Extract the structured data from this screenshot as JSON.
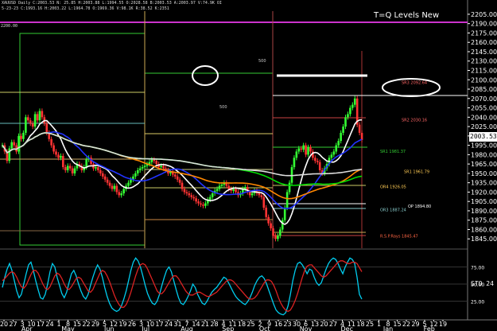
{
  "header": {
    "line1": "XAUUSD  Daily  C:2003.53  N: 25.85  H:2003.88  L:1994.55  O:2028.58  B:2003.53  A:2003.97  V:74.9K  OI",
    "line2": "5-23-23  C:1993.16  H:2003.22  L:1964.78  O:1969.36  V:98.1K  R:38.52  K:2351",
    "line3": "2200.00"
  },
  "levels_title": "T=Q Levels New",
  "price_badge": "2003.53",
  "sto_label": "STO 24",
  "chart_data": [
    {
      "type": "candlestick",
      "title": "XAUUSD Daily",
      "xlabel": "",
      "ylabel": "",
      "ylim": [
        1830,
        2210
      ],
      "y_ticks": [
        2205,
        2190,
        2175,
        2160,
        2145,
        2130,
        2115,
        2100,
        2085,
        2070,
        2055,
        2040,
        2025,
        2010,
        1995,
        1980,
        1965,
        1950,
        1935,
        1920,
        1905,
        1890,
        1875,
        1860,
        1845
      ],
      "y_tick_labels": [
        "2205.00",
        "2190.00",
        "2175.00",
        "2160.00",
        "2145.00",
        "2130.00",
        "2115.00",
        "2100.00",
        "2085.00",
        "2070.00",
        "2055.00",
        "2040.00",
        "2025.00",
        "2010.00",
        "1995.00",
        "1980.00",
        "1965.00",
        "1950.00",
        "1935.00",
        "1920.00",
        "1905.00",
        "1890.00",
        "1875.00",
        "1860.00",
        "1845.00"
      ],
      "x_day_labels": [
        "20",
        "27",
        "3",
        "10",
        "17",
        "24",
        "1",
        "8",
        "15",
        "22",
        "29",
        "5",
        "12",
        "19",
        "26",
        "3",
        "10",
        "17",
        "24",
        "31",
        "7",
        "14",
        "21",
        "28",
        "4",
        "11",
        "18",
        "25",
        "2",
        "9",
        "16",
        "23",
        "30",
        "6",
        "13",
        "20",
        "27",
        "4",
        "11",
        "18",
        "25",
        "1",
        "8",
        "15",
        "22",
        "29",
        "5",
        "12",
        "19"
      ],
      "x_month_labels": [
        "Apr",
        "May",
        "Jun",
        "Jul",
        "Aug",
        "Sep",
        "Oct",
        "Nov",
        "Dec",
        "Jan",
        "Feb"
      ],
      "last_price": 2003.53,
      "close": [
        1995,
        1985,
        1970,
        1990,
        2000,
        1995,
        1985,
        2010,
        2005,
        2015,
        2040,
        2035,
        2030,
        2025,
        2045,
        2035,
        2050,
        2040,
        2030,
        2015,
        2005,
        1995,
        1985,
        1980,
        1975,
        1978,
        1960,
        1955,
        1962,
        1958,
        1950,
        1958,
        1965,
        1962,
        1955,
        1960,
        1972,
        1975,
        1965,
        1958,
        1960,
        1955,
        1950,
        1945,
        1940,
        1935,
        1930,
        1925,
        1930,
        1920,
        1915,
        1918,
        1925,
        1930,
        1935,
        1940,
        1945,
        1950,
        1955,
        1958,
        1960,
        1962,
        1965,
        1968,
        1972,
        1970,
        1965,
        1960,
        1962,
        1958,
        1955,
        1950,
        1952,
        1948,
        1945,
        1940,
        1935,
        1925,
        1920,
        1918,
        1915,
        1912,
        1910,
        1905,
        1902,
        1900,
        1898,
        1902,
        1908,
        1912,
        1918,
        1922,
        1925,
        1930,
        1932,
        1935,
        1930,
        1925,
        1922,
        1925,
        1920,
        1915,
        1918,
        1925,
        1928,
        1920,
        1915,
        1918,
        1922,
        1918,
        1915,
        1912,
        1895,
        1880,
        1870,
        1862,
        1850,
        1845,
        1850,
        1860,
        1875,
        1895,
        1920,
        1935,
        1960,
        1975,
        1985,
        1990,
        1988,
        1995,
        1980,
        1992,
        1985,
        1975,
        1970,
        1968,
        1955,
        1950,
        1958,
        1965,
        1975,
        1980,
        1985,
        1995,
        2002,
        2015,
        2025,
        2040,
        2045,
        2055,
        2060,
        2070,
        2028,
        2015,
        2003.53
      ],
      "moving_averages": [
        {
          "color": "#ffffff",
          "period": 10
        },
        {
          "color": "#2233ff",
          "period": 20
        },
        {
          "color": "#ff8800",
          "period": 50
        },
        {
          "color": "#00dd00",
          "period": 100
        },
        {
          "color": "#dddddd",
          "period": 200
        }
      ],
      "level_labels": [
        {
          "text": "500",
          "price": 2127
        },
        {
          "text": "500",
          "price": 2053
        },
        {
          "text": "SR3 2092.64",
          "price": 2092
        },
        {
          "text": "SR2 2030.16",
          "price": 2032
        },
        {
          "text": "SR1 1981.37",
          "price": 1982
        },
        {
          "text": "SR1 1961.79",
          "price": 1949
        },
        {
          "text": "OR4 1926.05",
          "price": 1925
        },
        {
          "text": "OP 1894.80",
          "price": 1894
        },
        {
          "text": "OR3 1887.24",
          "price": 1888
        },
        {
          "text": "R.S.P.Rays 1845.47",
          "price": 1846
        }
      ]
    },
    {
      "type": "line",
      "title": "STO 24",
      "ylim": [
        0,
        100
      ],
      "y_ticks": [
        75,
        50,
        25
      ],
      "y_tick_labels": [
        "75.00",
        "50.00",
        "25.00"
      ],
      "series": [
        {
          "name": "",
          "color": "#00ccee",
          "values": [
            45,
            60,
            72,
            80,
            70,
            55,
            40,
            30,
            35,
            50,
            65,
            78,
            82,
            70,
            55,
            42,
            30,
            28,
            35,
            50,
            68,
            80,
            75,
            60,
            48,
            36,
            30,
            38,
            52,
            65,
            70,
            62,
            50,
            40,
            32,
            28,
            35,
            48,
            60,
            70,
            78,
            72,
            60,
            45,
            32,
            22,
            15,
            12,
            10,
            12,
            18,
            28,
            40,
            55,
            70,
            82,
            88,
            84,
            75,
            62,
            48,
            36,
            28,
            22,
            20,
            25,
            35,
            48,
            60,
            70,
            75,
            68,
            55,
            42,
            30,
            22,
            20,
            25,
            32,
            40,
            50,
            45,
            35,
            28,
            22,
            20,
            25,
            32,
            38,
            42,
            45,
            50,
            55,
            60,
            58,
            52,
            45,
            38,
            32,
            28,
            25,
            22,
            20,
            24,
            30,
            38,
            48,
            55,
            60,
            62,
            58,
            50,
            40,
            30,
            20,
            12,
            8,
            6,
            5,
            8,
            18,
            35,
            55,
            70,
            80,
            82,
            78,
            72,
            65,
            72,
            70,
            60,
            52,
            48,
            52,
            62,
            72,
            80,
            85,
            88,
            86,
            80,
            72,
            65,
            75,
            82,
            88,
            86,
            80,
            60,
            35,
            28
          ]
        },
        {
          "name": "",
          "color": "#dd2222",
          "values": [
            55,
            58,
            62,
            66,
            68,
            66,
            60,
            52,
            46,
            44,
            48,
            56,
            64,
            70,
            70,
            66,
            58,
            50,
            44,
            42,
            46,
            54,
            62,
            66,
            64,
            58,
            50,
            44,
            42,
            46,
            52,
            58,
            60,
            58,
            52,
            46,
            40,
            38,
            42,
            50,
            58,
            66,
            70,
            68,
            62,
            54,
            44,
            34,
            26,
            20,
            16,
            16,
            20,
            28,
            38,
            50,
            62,
            72,
            78,
            80,
            78,
            72,
            64,
            56,
            48,
            40,
            36,
            36,
            40,
            46,
            52,
            58,
            62,
            62,
            58,
            52,
            46,
            40,
            36,
            34,
            34,
            36,
            38,
            38,
            36,
            34,
            32,
            32,
            34,
            36,
            38,
            42,
            46,
            50,
            54,
            56,
            56,
            54,
            50,
            46,
            42,
            38,
            34,
            30,
            28,
            28,
            30,
            34,
            40,
            46,
            52,
            56,
            56,
            54,
            48,
            40,
            30,
            22,
            16,
            12,
            10,
            12,
            18,
            26,
            36,
            48,
            60,
            70,
            76,
            78,
            78,
            74,
            70,
            66,
            62,
            60,
            62,
            66,
            70,
            74,
            78,
            82,
            84,
            84,
            82,
            80,
            80,
            82,
            82,
            80,
            74,
            68
          ]
        }
      ]
    }
  ]
}
